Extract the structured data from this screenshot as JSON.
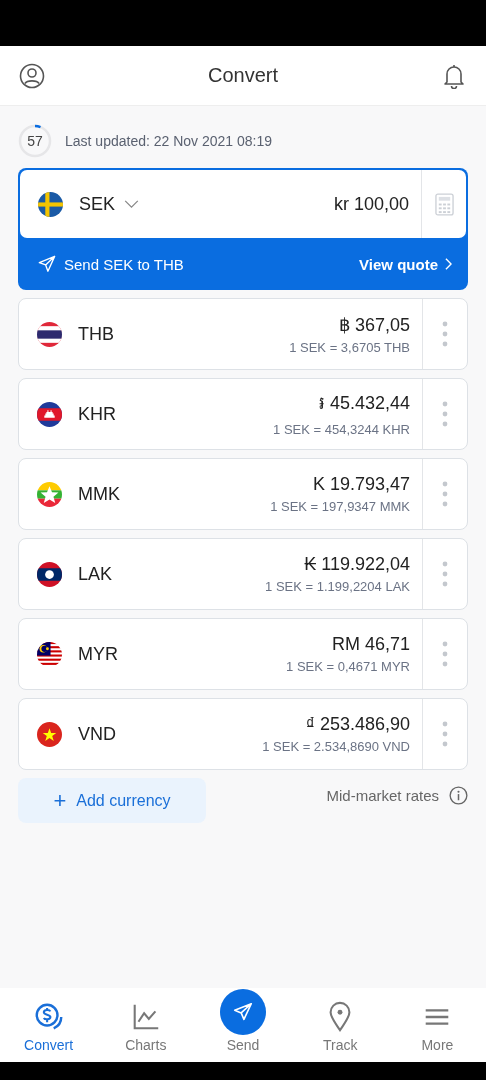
{
  "header": {
    "title": "Convert"
  },
  "update": {
    "countdown": "57",
    "text": "Last updated: 22 Nov 2021 08:19"
  },
  "base": {
    "code": "SEK",
    "amount": "kr 100,00",
    "send_label": "Send SEK to THB",
    "quote_label": "View quote"
  },
  "currencies": [
    {
      "kind": "th",
      "code": "THB",
      "amount": "฿ 367,05",
      "rate": "1 SEK = 3,6705 THB"
    },
    {
      "kind": "kh",
      "code": "KHR",
      "amount": "៛ 45.432,44",
      "rate": "1 SEK = 454,3244 KHR"
    },
    {
      "kind": "mm",
      "code": "MMK",
      "amount": "K 19.793,47",
      "rate": "1 SEK = 197,9347 MMK"
    },
    {
      "kind": "la",
      "code": "LAK",
      "amount": "₭ 119.922,04",
      "rate": "1 SEK = 1.199,2204 LAK"
    },
    {
      "kind": "my",
      "code": "MYR",
      "amount": "RM 46,71",
      "rate": "1 SEK = 0,4671 MYR"
    },
    {
      "kind": "vn",
      "code": "VND",
      "amount": "₫ 253.486,90",
      "rate": "1 SEK = 2.534,8690 VND"
    }
  ],
  "add_button": "Add currency",
  "add_plus": "+",
  "rates_note": "Mid-market rates",
  "nav": [
    {
      "label": "Convert",
      "selected": true
    },
    {
      "label": "Charts",
      "selected": false
    },
    {
      "label": "Send",
      "selected": false
    },
    {
      "label": "Track",
      "selected": false
    },
    {
      "label": "More",
      "selected": false
    }
  ]
}
